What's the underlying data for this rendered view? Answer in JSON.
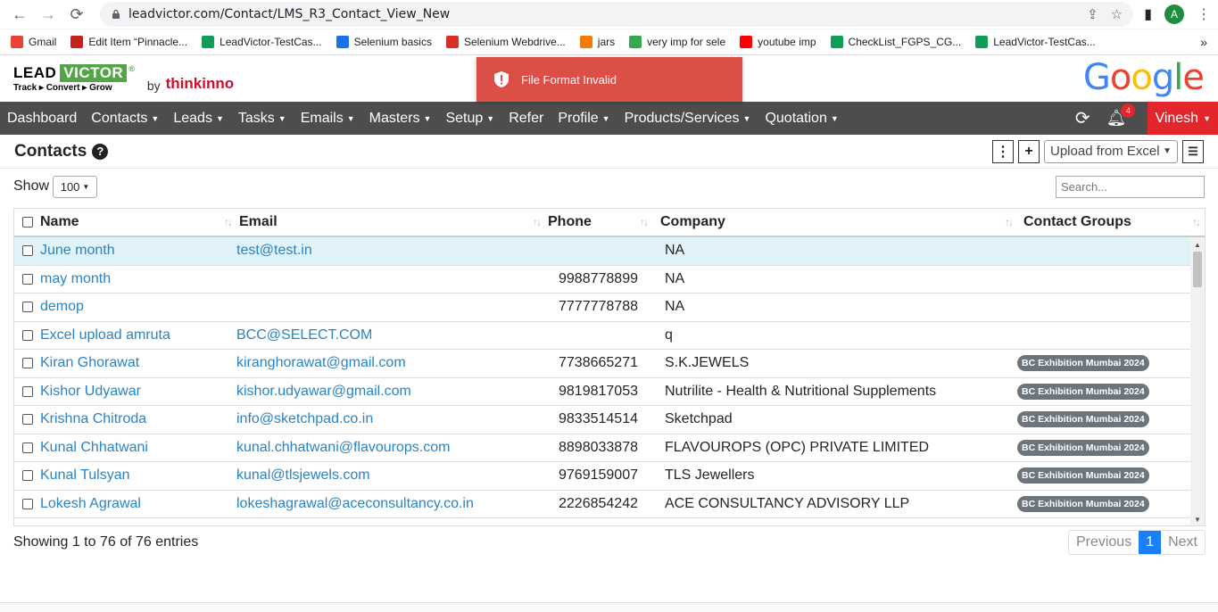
{
  "browser": {
    "url": "leadvictor.com/Contact/LMS_R3_Contact_View_New",
    "avatar_letter": "A",
    "bookmarks": [
      {
        "label": "Gmail",
        "color": "#ea4335"
      },
      {
        "label": "Edit Item “Pinnacle...",
        "color": "#c5221f"
      },
      {
        "label": "LeadVictor-TestCas...",
        "color": "#0f9d58"
      },
      {
        "label": "Selenium basics",
        "color": "#1a73e8"
      },
      {
        "label": "Selenium Webdrive...",
        "color": "#d93025"
      },
      {
        "label": "jars",
        "color": "#f57c00"
      },
      {
        "label": "very imp for sele",
        "color": "#34a853"
      },
      {
        "label": "youtube imp",
        "color": "#ff0000"
      },
      {
        "label": "CheckList_FGPS_CG...",
        "color": "#0f9d58"
      },
      {
        "label": "LeadVictor-TestCas...",
        "color": "#0f9d58"
      }
    ],
    "more": "»"
  },
  "header": {
    "logo_lead": "LEAD",
    "logo_victor": "VICTOR",
    "logo_reg": "®",
    "logo_tagline": "Track ▸ Convert ▸ Grow",
    "logo_by": "by",
    "logo_thinkinno": "thinkinno",
    "toast_message": "File Format Invalid",
    "google_letters": [
      "G",
      "o",
      "o",
      "g",
      "l",
      "e"
    ]
  },
  "nav": {
    "items": [
      {
        "label": "Dashboard",
        "dropdown": false
      },
      {
        "label": "Contacts",
        "dropdown": true
      },
      {
        "label": "Leads",
        "dropdown": true
      },
      {
        "label": "Tasks",
        "dropdown": true
      },
      {
        "label": "Emails",
        "dropdown": true
      },
      {
        "label": "Masters",
        "dropdown": true
      },
      {
        "label": "Setup",
        "dropdown": true
      },
      {
        "label": "Refer",
        "dropdown": false
      },
      {
        "label": "Profile",
        "dropdown": true
      },
      {
        "label": "Products/Services",
        "dropdown": true
      },
      {
        "label": "Quotation",
        "dropdown": true
      }
    ],
    "notification_count": "4",
    "user_name": "Vinesh"
  },
  "page": {
    "title": "Contacts",
    "upload_select": "Upload from Excel",
    "show_label": "Show",
    "show_value": "100",
    "search_placeholder": "Search...",
    "entries_info": "Showing 1 to 76 of 76 entries",
    "pager": {
      "previous": "Previous",
      "current": "1",
      "next": "Next"
    }
  },
  "table": {
    "columns": [
      "Name",
      "Email",
      "Phone",
      "Company",
      "Contact Groups"
    ],
    "rows": [
      {
        "name": "June month",
        "email": "test@test.in",
        "phone": "",
        "company": "NA",
        "group": ""
      },
      {
        "name": "may month",
        "email": "",
        "phone": "9988778899",
        "company": "NA",
        "group": ""
      },
      {
        "name": "demop",
        "email": "",
        "phone": "7777778788",
        "company": "NA",
        "group": ""
      },
      {
        "name": "Excel upload amruta",
        "email": "BCC@SELECT.COM",
        "phone": "",
        "company": "q",
        "group": ""
      },
      {
        "name": "Kiran Ghorawat",
        "email": "kiranghorawat@gmail.com",
        "phone": "7738665271",
        "company": "S.K.JEWELS",
        "group": "BC Exhibition Mumbai 2024"
      },
      {
        "name": "Kishor Udyawar",
        "email": "kishor.udyawar@gmail.com",
        "phone": "9819817053",
        "company": "Nutrilite - Health & Nutritional Supplements",
        "group": "BC Exhibition Mumbai 2024"
      },
      {
        "name": "Krishna Chitroda",
        "email": "info@sketchpad.co.in",
        "phone": "9833514514",
        "company": "Sketchpad",
        "group": "BC Exhibition Mumbai 2024"
      },
      {
        "name": "Kunal Chhatwani",
        "email": "kunal.chhatwani@flavourops.com",
        "phone": "8898033878",
        "company": "FLAVOUROPS (OPC) PRIVATE LIMITED",
        "group": "BC Exhibition Mumbai 2024"
      },
      {
        "name": "Kunal Tulsyan",
        "email": "kunal@tlsjewels.com",
        "phone": "9769159007",
        "company": "TLS Jewellers",
        "group": "BC Exhibition Mumbai 2024"
      },
      {
        "name": "Lokesh Agrawal",
        "email": "lokeshagrawal@aceconsultancy.co.in",
        "phone": "2226854242",
        "company": "ACE CONSULTANCY ADVISORY LLP",
        "group": "BC Exhibition Mumbai 2024"
      }
    ]
  },
  "colors": {
    "navbar": "#4d4d4d",
    "user_button": "#e3262c",
    "toast": "#dc4f47",
    "link": "#2a83c4",
    "highlight_row": "#e1f2f8",
    "badge": "#6c757d",
    "brand_green": "#53a548",
    "brand_red": "#c8102e"
  }
}
